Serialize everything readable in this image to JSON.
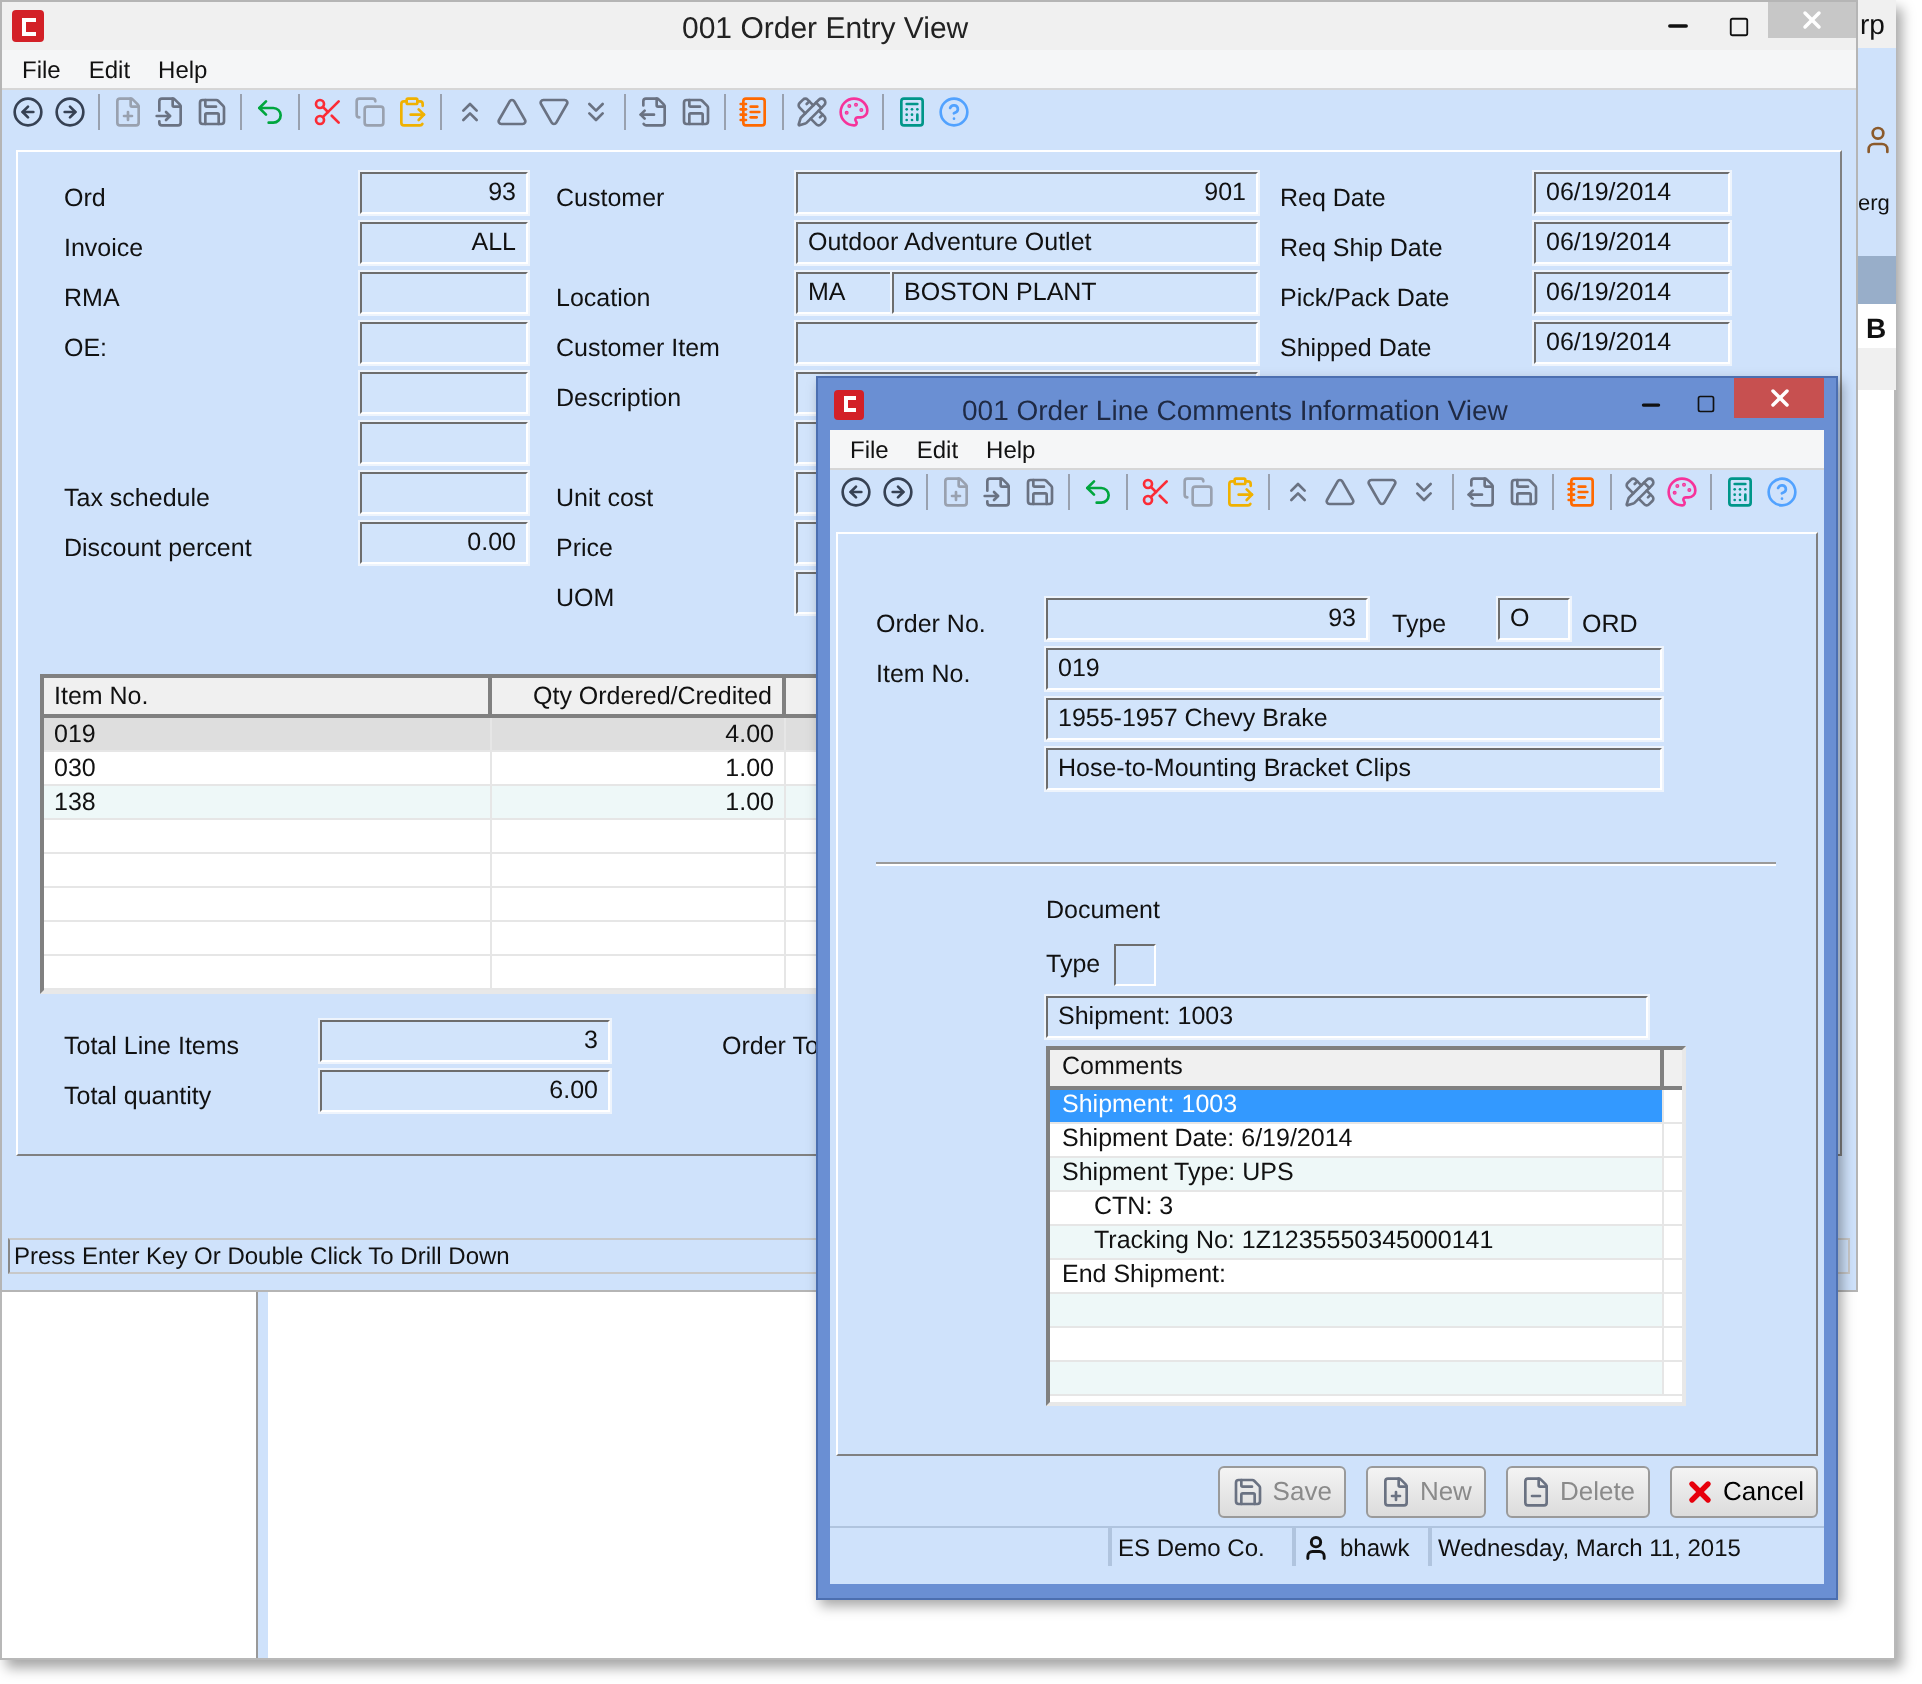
{
  "background_window": {
    "title_fragment": "rp",
    "label_fragment": "erg",
    "tab_fragment": "B"
  },
  "main_window": {
    "title": "001 Order Entry View",
    "menu": [
      "File",
      "Edit",
      "Help"
    ],
    "left_fields": [
      {
        "kind": "field",
        "label": "Ord",
        "value": "93"
      },
      {
        "kind": "field",
        "label": "Invoice",
        "value": "ALL"
      },
      {
        "kind": "field",
        "label": "RMA"
      },
      {
        "kind": "field",
        "label": "OE:"
      },
      {
        "kind": "field"
      },
      {
        "kind": "field"
      },
      {
        "kind": "field",
        "label": "Tax schedule"
      },
      {
        "kind": "field",
        "label": "Discount percent",
        "value": "0.00"
      }
    ],
    "middle_fields": [
      {
        "label": "Customer",
        "fields": [
          {
            "kind": "number",
            "value": "901"
          }
        ]
      },
      {
        "fields": [
          {
            "kind": "text",
            "value": "Outdoor Adventure Outlet"
          }
        ]
      },
      {
        "label": "Location",
        "fields": [
          {
            "kind": "code",
            "value": "MA"
          },
          {
            "kind": "text",
            "value": "BOSTON PLANT"
          }
        ]
      },
      {
        "label": "Customer Item",
        "fields": [
          {
            "kind": "text"
          }
        ]
      },
      {
        "label": "Description",
        "fields": [
          {
            "kind": "text"
          }
        ]
      },
      {
        "fields": [
          {
            "kind": "text"
          }
        ]
      },
      {
        "label": "Unit cost",
        "fields": [
          {
            "kind": "text"
          }
        ]
      },
      {
        "label": "Price",
        "fields": [
          {
            "kind": "text"
          }
        ]
      },
      {
        "label": "UOM",
        "fields": [
          {
            "kind": "text"
          }
        ]
      }
    ],
    "date_fields": [
      {
        "label": "Req Date",
        "value": "06/19/2014"
      },
      {
        "label": "Req Ship Date",
        "value": "06/19/2014"
      },
      {
        "label": "Pick/Pack Date",
        "value": "06/19/2014"
      },
      {
        "label": "Shipped Date",
        "value": "06/19/2014"
      }
    ],
    "lines_table": {
      "columns": [
        "Item No.",
        "Qty Ordered/Credited"
      ],
      "rows": [
        {
          "item": "019",
          "qty": "4.00",
          "selected": true
        },
        {
          "item": "030",
          "qty": "1.00",
          "selected": false
        },
        {
          "item": "138",
          "qty": "1.00",
          "selected": false
        }
      ]
    },
    "totals": [
      {
        "label": "Total Line Items",
        "value": "3"
      },
      {
        "label": "Total quantity",
        "value": "6.00"
      }
    ],
    "order_total_label": "Order To",
    "status_bar": "Press Enter Key Or Double Click To Drill Down"
  },
  "dialog": {
    "title": "001 Order Line Comments Information View",
    "menu": [
      "File",
      "Edit",
      "Help"
    ],
    "order_no": {
      "label": "Order No.",
      "value": "93"
    },
    "type": {
      "label": "Type",
      "value": "O",
      "description": "ORD"
    },
    "item": {
      "label": "Item No.",
      "lines": [
        "019",
        "1955-1957 Chevy Brake",
        "Hose-to-Mounting Bracket Clips"
      ]
    },
    "document": {
      "label": "Document",
      "type_label": "Type",
      "value": "Shipment: 1003"
    },
    "comments": {
      "column": "Comments",
      "rows": [
        {
          "text": "Shipment: 1003",
          "selected": true
        },
        {
          "text": "Shipment Date: 6/19/2014",
          "selected": false
        },
        {
          "text": "Shipment Type: UPS",
          "selected": false,
          "children": [
            {
              "text": "CTN: 3",
              "selected": false
            },
            {
              "text": "Tracking No: 1Z1235550345000141",
              "selected": false
            }
          ]
        },
        {
          "text": "End Shipment:",
          "selected": false
        }
      ]
    },
    "buttons": [
      {
        "kind": "save",
        "label": "Save",
        "disabled": true
      },
      {
        "kind": "new",
        "label": "New",
        "disabled": true
      },
      {
        "kind": "delete",
        "label": "Delete",
        "disabled": true
      },
      {
        "kind": "cancel",
        "label": "Cancel",
        "disabled": false
      }
    ],
    "status_bar": {
      "company": "ES Demo Co.",
      "user": "bhawk",
      "date": "Wednesday, March 11, 2015"
    }
  }
}
